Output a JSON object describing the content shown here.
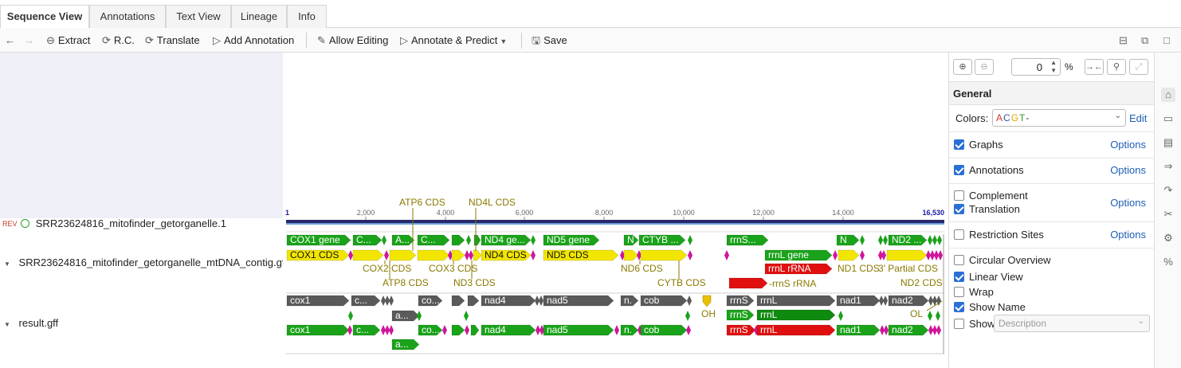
{
  "tabs": [
    {
      "label": "Sequence View",
      "active": true
    },
    {
      "label": "Annotations"
    },
    {
      "label": "Text View"
    },
    {
      "label": "Lineage"
    },
    {
      "label": "Info"
    }
  ],
  "toolbar": {
    "extract": "Extract",
    "rc": "R.C.",
    "translate": "Translate",
    "add_annotation": "Add Annotation",
    "allow_editing": "Allow Editing",
    "annotate_predict": "Annotate & Predict",
    "save": "Save"
  },
  "left": {
    "rev": "REV",
    "sequence_name": "SRR23624816_mitofinder_getorganelle.1",
    "track1": "SRR23624816_mitofinder_getorganelle_mtDNA_contig.gff",
    "track2": "result.gff"
  },
  "ruler": {
    "start": "1",
    "end": "16,530",
    "ticks": [
      "2,000",
      "4,000",
      "6,000",
      "8,000",
      "10,000",
      "12,000",
      "14,000"
    ]
  },
  "feature_labels": {
    "atp6": "ATP6 CDS",
    "nd4l": "ND4L CDS",
    "cox2": "COX2 CDS",
    "cox3": "COX3 CDS",
    "atp8": "ATP8 CDS",
    "nd3": "ND3 CDS",
    "nd6": "ND6 CDS",
    "cytb": "CYTB CDS",
    "nd1": "ND1 CDS",
    "partial": "3' Partial CDS",
    "nd2": "ND2 CDS",
    "rrns_rrna": "rrnS rRNA",
    "oh": "OH",
    "ol": "OL"
  },
  "features": {
    "cox1_gene": "COX1 gene",
    "c_trunc": "C...",
    "a_trunc": "A...",
    "nd4_gene": "ND4 ge...",
    "nd5_gene": "ND5 gene",
    "n": "N",
    "cytb_gene": "CTYB ...",
    "rrns_trunc": "rrnS...",
    "nd2_trunc": "ND2 ...",
    "cox1_cds": "COX1 CDS",
    "nd4_cds": "ND4 CDS",
    "nd5_cds": "ND5 CDS",
    "rrnl_gene": "rrnL gene",
    "rrnl_rrna": "rrnL rRNA",
    "cox1": "cox1",
    "c_small": "c...",
    "co_trunc": "co...",
    "nad4": "nad4",
    "nad5": "nad5",
    "n_dot": "n.",
    "cob": "cob",
    "rrns": "rrnS",
    "rrnl": "rrnL",
    "nad1": "nad1",
    "nad2": "nad2",
    "a_small": "a..."
  },
  "zoom": {
    "value": "0",
    "unit": "%"
  },
  "panel": {
    "title": "General",
    "colors_label": "Colors:",
    "colors_letters": [
      {
        "t": "A",
        "c": "#d4342c"
      },
      {
        "t": "C",
        "c": "#2a52be"
      },
      {
        "t": "G",
        "c": "#e8a200"
      },
      {
        "t": "T",
        "c": "#2e9a2e"
      },
      {
        "t": "-",
        "c": "#333333"
      }
    ],
    "edit": "Edit",
    "options": "Options",
    "graphs": "Graphs",
    "annotations": "Annotations",
    "complement": "Complement",
    "translation": "Translation",
    "restriction_sites": "Restriction Sites",
    "circular_overview": "Circular Overview",
    "linear_view": "Linear View",
    "wrap": "Wrap",
    "show_name": "Show Name",
    "show": "Show",
    "show_select": "Description"
  },
  "checkbox_state": {
    "graphs": true,
    "annotations": true,
    "complement": false,
    "translation": true,
    "restriction_sites": false,
    "circular_overview": false,
    "linear_view": true,
    "wrap": false,
    "show_name": true,
    "show": false
  },
  "feature_colors": {
    "gene": "#1aa31a",
    "cds": "#f2e600",
    "intergenic": "#d0169a",
    "grey": "#5a5a5a",
    "rrna": "#e01010",
    "label": "#8a7a00"
  }
}
